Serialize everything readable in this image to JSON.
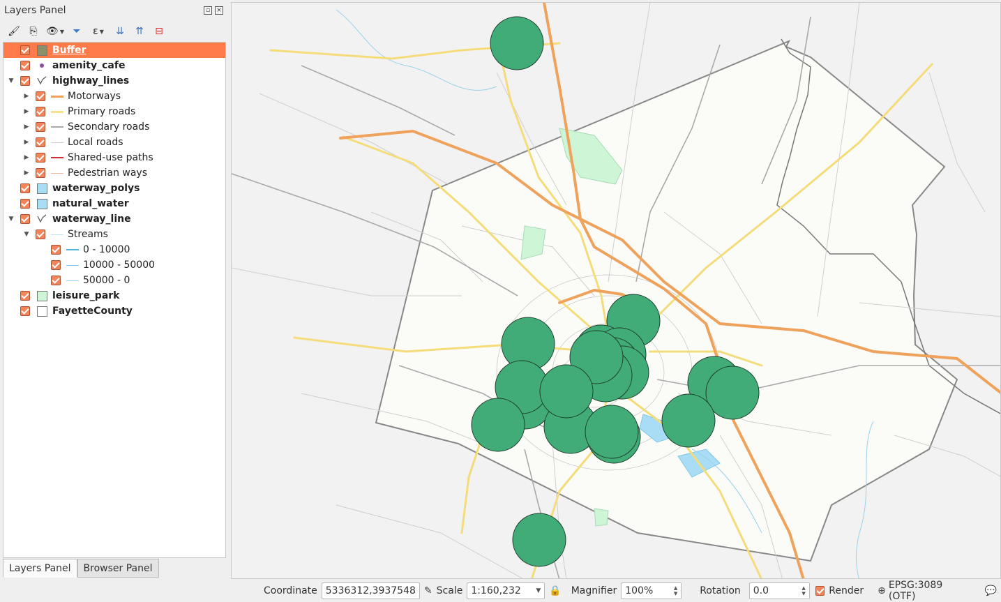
{
  "panel": {
    "title": "Layers Panel",
    "toolbar_icons": [
      "add-group-icon",
      "manage-map-themes-icon",
      "visibility-icon",
      "filter-legend-icon",
      "expression-filter-icon",
      "expand-all-icon",
      "collapse-all-icon",
      "remove-layer-icon"
    ]
  },
  "layers": [
    {
      "label": "Buffer",
      "bold": true,
      "selected": true,
      "checked": true,
      "level": 0,
      "expander": "",
      "symbol": "fill",
      "color": "#8b8f6a"
    },
    {
      "label": "amenity_cafe",
      "bold": true,
      "checked": true,
      "level": 0,
      "expander": "",
      "symbol": "dot",
      "color": "#8f4f9d"
    },
    {
      "label": "highway_lines",
      "bold": true,
      "checked": true,
      "level": 0,
      "expander": "▼",
      "symbol": "lineicon",
      "color": "#666666"
    },
    {
      "label": "Motorways",
      "checked": true,
      "level": 1,
      "expander": "▶",
      "symbol": "line",
      "color": "#f0a05a",
      "width": 3
    },
    {
      "label": "Primary roads",
      "checked": true,
      "level": 1,
      "expander": "▶",
      "symbol": "line",
      "color": "#f5e28a",
      "width": 3
    },
    {
      "label": "Secondary roads",
      "checked": true,
      "level": 1,
      "expander": "▶",
      "symbol": "line",
      "color": "#aaaaaa",
      "width": 2
    },
    {
      "label": "Local roads",
      "checked": true,
      "level": 1,
      "expander": "▶",
      "symbol": "line",
      "color": "#d0d0d0",
      "width": 1
    },
    {
      "label": "Shared-use paths",
      "checked": true,
      "level": 1,
      "expander": "▶",
      "symbol": "line",
      "color": "#d62a3a",
      "width": 2
    },
    {
      "label": "Pedestrian ways",
      "checked": true,
      "level": 1,
      "expander": "▶",
      "symbol": "line",
      "color": "#f2b6a0",
      "width": 1
    },
    {
      "label": "waterway_polys",
      "bold": true,
      "checked": true,
      "level": 0,
      "expander": "",
      "symbol": "fill",
      "color": "#a8ddf5"
    },
    {
      "label": "natural_water",
      "bold": true,
      "checked": true,
      "level": 0,
      "expander": "",
      "symbol": "fill",
      "color": "#a8ddf5"
    },
    {
      "label": "waterway_line",
      "bold": true,
      "checked": true,
      "level": 0,
      "expander": "▼",
      "symbol": "lineicon",
      "color": "#666666"
    },
    {
      "label": "Streams",
      "checked": true,
      "level": 1,
      "expander": "▼",
      "symbol": "line",
      "color": "#bfe3f3",
      "width": 1
    },
    {
      "label": "0 - 10000",
      "checked": true,
      "level": 2,
      "expander": "",
      "symbol": "line",
      "color": "#4fb6e0",
      "width": 2
    },
    {
      "label": "10000 - 50000",
      "checked": true,
      "level": 2,
      "expander": "",
      "symbol": "line",
      "color": "#7fc8e6",
      "width": 1
    },
    {
      "label": "50000 - 0",
      "checked": true,
      "level": 2,
      "expander": "",
      "symbol": "line",
      "color": "#9ad2ea",
      "width": 1
    },
    {
      "label": "leisure_park",
      "bold": true,
      "checked": true,
      "level": 0,
      "expander": "",
      "symbol": "fill",
      "color": "#cdf5d6"
    },
    {
      "label": "FayetteCounty",
      "bold": true,
      "checked": true,
      "level": 0,
      "expander": "",
      "symbol": "fill",
      "color": "#ffffff"
    }
  ],
  "tabs": {
    "layers": "Layers Panel",
    "browser": "Browser Panel"
  },
  "status": {
    "coordinate_label": "Coordinate",
    "coordinate_value": "5336312,3937548",
    "scale_label": "Scale",
    "scale_value": "1:160,232",
    "magnifier_label": "Magnifier",
    "magnifier_value": "100%",
    "rotation_label": "Rotation",
    "rotation_value": "0.0",
    "render_label": "Render",
    "crs_label": "EPSG:3089 (OTF)"
  },
  "map_colors": {
    "buffer": "#42ac78",
    "county_fill": "#fbfbf8",
    "background": "#f2f2f2"
  }
}
